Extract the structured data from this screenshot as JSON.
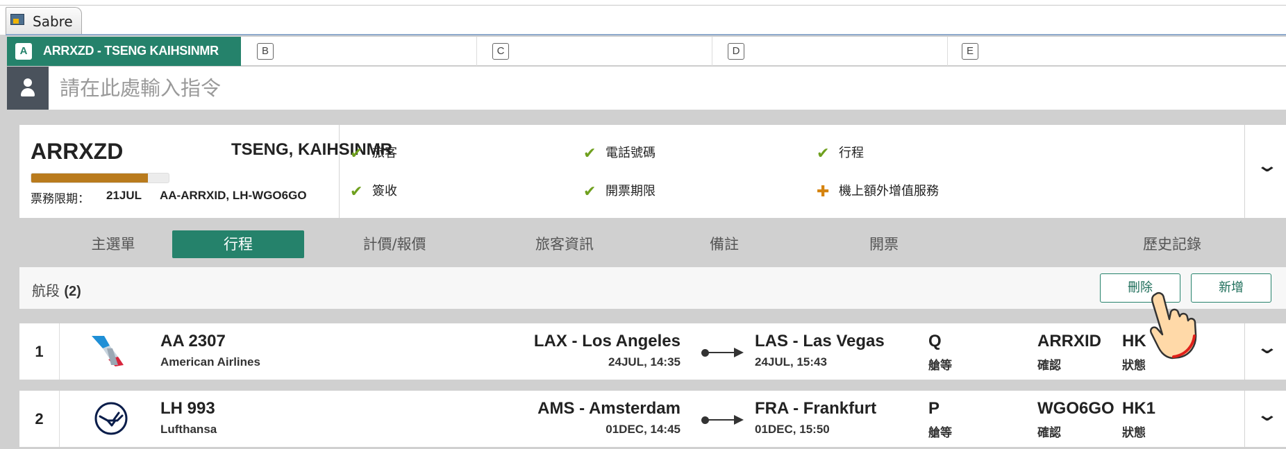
{
  "window": {
    "tab_title": "Sabre"
  },
  "workspace_tabs": [
    {
      "key": "A",
      "label": "ARRXZD - TSENG KAIHSINMR",
      "active": true
    },
    {
      "key": "B",
      "label": ""
    },
    {
      "key": "C",
      "label": ""
    },
    {
      "key": "D",
      "label": ""
    },
    {
      "key": "E",
      "label": ""
    }
  ],
  "command": {
    "placeholder": "請在此處輸入指令",
    "value": ""
  },
  "pnr": {
    "code": "ARRXZD",
    "passenger_name": "TSENG, KAIHSINMR",
    "completion_fraction": 0.85,
    "ticketing_deadline_label": "票務限期：",
    "ticketing_deadline": "21JUL",
    "record_locators": "AA-ARRXID, LH-WGO6GO",
    "checklist": [
      {
        "label": "旅客",
        "status": "done"
      },
      {
        "label": "電話號碼",
        "status": "done"
      },
      {
        "label": "行程",
        "status": "done"
      },
      {
        "label": "簽收",
        "status": "done"
      },
      {
        "label": "開票期限",
        "status": "done"
      },
      {
        "label": "機上額外增值服務",
        "status": "add"
      }
    ]
  },
  "subnav": [
    {
      "label": "主選單",
      "active": false
    },
    {
      "label": "行程",
      "active": true
    },
    {
      "label": "計價/報價",
      "active": false
    },
    {
      "label": "旅客資訊",
      "active": false
    },
    {
      "label": "備註",
      "active": false
    },
    {
      "label": "開票",
      "active": false
    },
    {
      "label": "歷史記錄",
      "active": false
    }
  ],
  "segments_header": {
    "title": "航段",
    "count": "(2)",
    "delete_label": "刪除",
    "add_label": "新增"
  },
  "segments": [
    {
      "index": "1",
      "airline_logo": "american-airlines-logo",
      "flight": "AA 2307",
      "airline": "American Airlines",
      "origin": "LAX - Los Angeles",
      "depart": "24JUL, 14:35",
      "destination": "LAS - Las Vegas",
      "arrive": "24JUL, 15:43",
      "class": "Q",
      "class_label": "艙等",
      "confirmation": "ARRXID",
      "confirmation_label": "確認",
      "status": "HK",
      "status_label": "狀態"
    },
    {
      "index": "2",
      "airline_logo": "lufthansa-logo",
      "flight": "LH 993",
      "airline": "Lufthansa",
      "origin": "AMS - Amsterdam",
      "depart": "01DEC, 14:45",
      "destination": "FRA - Frankfurt",
      "arrive": "01DEC, 15:50",
      "class": "P",
      "class_label": "艙等",
      "confirmation": "WGO6GO",
      "confirmation_label": "確認",
      "status": "HK1",
      "status_label": "狀態"
    }
  ],
  "colors": {
    "accent": "#25826b",
    "progress": "#b97b1d",
    "check": "#6fa01e",
    "plus": "#d58410"
  }
}
